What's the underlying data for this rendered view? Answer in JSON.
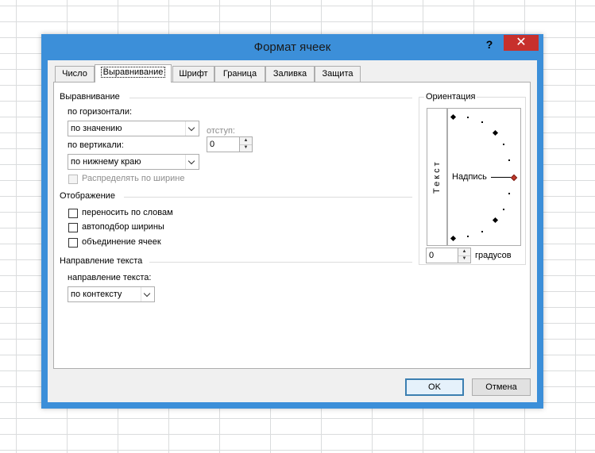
{
  "dialog": {
    "title": "Формат ячеек",
    "help": "?",
    "close": "✕"
  },
  "tabs": [
    {
      "label": "Число"
    },
    {
      "label": "Выравнивание"
    },
    {
      "label": "Шрифт"
    },
    {
      "label": "Граница"
    },
    {
      "label": "Заливка"
    },
    {
      "label": "Защита"
    }
  ],
  "active_tab": "Выравнивание",
  "alignment": {
    "section": "Выравнивание",
    "horizontal_label": "по горизонтали:",
    "horizontal_value": "по значению",
    "vertical_label": "по вертикали:",
    "vertical_value": "по нижнему краю",
    "indent_label": "отступ:",
    "indent_value": "0",
    "distribute_label": "Распределять по ширине"
  },
  "display": {
    "section": "Отображение",
    "wrap_label": "переносить по словам",
    "shrink_label": "автоподбор ширины",
    "merge_label": "объединение ячеек"
  },
  "direction": {
    "section": "Направление текста",
    "label": "направление текста:",
    "value": "по контексту"
  },
  "orientation": {
    "section": "Ориентация",
    "vertical_text": "Текст",
    "dial_label": "Надпись",
    "degrees_value": "0",
    "degrees_label": "градусов"
  },
  "buttons": {
    "ok": "OK",
    "cancel": "Отмена"
  },
  "colors": {
    "frame": "#3c8fd9",
    "close_button": "#c7302c"
  }
}
